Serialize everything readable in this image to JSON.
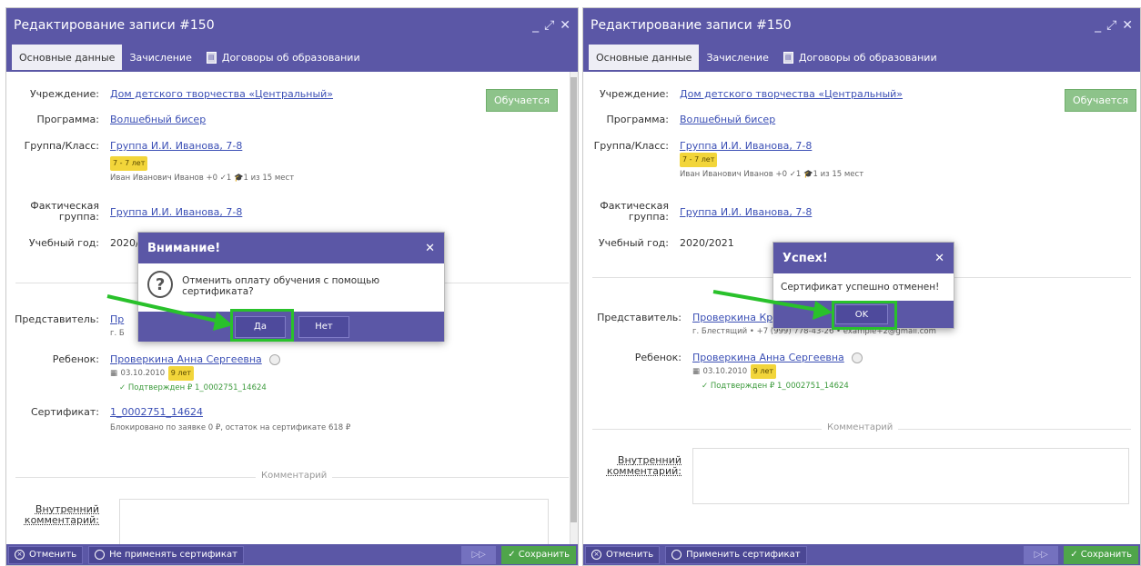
{
  "left": {
    "window_title": "Редактирование записи #150",
    "tabs": [
      "Основные данные",
      "Зачисление",
      "Договоры об образовании"
    ],
    "status": "Обучается",
    "fields": {
      "institution_label": "Учреждение:",
      "institution": "Дом детского творчества «Центральный»",
      "program_label": "Программа:",
      "program": "Волшебный бисер",
      "group_label": "Группа/Класс:",
      "group": "Группа И.И. Иванова, 7-8",
      "age_badge": "7 - 7 лет",
      "teacher_line": "Иван Иванович Иванов   +0  ✓1  🎓1   из 15 мест",
      "actual_group_label": "Фактическая группа:",
      "actual_group": "Группа И.И. Иванова, 7-8",
      "year_label": "Учебный год:",
      "year": "2020/",
      "rep_label": "Представитель:",
      "rep_partial": "Пр",
      "rep_sub": "г. Б",
      "child_label": "Ребенок:",
      "child": "Проверкина Анна Сергеевна",
      "child_dob": "03.10.2010",
      "child_age": "9 лет",
      "child_confirm": "✓ Подтвержден   ₽ 1_0002751_14624",
      "cert_label": "Сертификат:",
      "cert": "1_0002751_14624",
      "cert_sub": "Блокировано по заявке 0 ₽, остаток на сертификате 618 ₽",
      "comment_section": "Комментарий",
      "internal_comment_label": "Внутренний комментарий:"
    },
    "footer": {
      "cancel": "Отменить",
      "no_cert": "Не применять сертификат",
      "next": "▷▷",
      "save": "✓ Сохранить"
    },
    "modal": {
      "title": "Внимание!",
      "message": "Отменить оплату обучения с помощью сертификата?",
      "yes": "Да",
      "no": "Нет"
    }
  },
  "right": {
    "window_title": "Редактирование записи #150",
    "tabs": [
      "Основные данные",
      "Зачисление",
      "Договоры об образовании"
    ],
    "status": "Обучается",
    "fields": {
      "institution_label": "Учреждение:",
      "institution": "Дом детского творчества «Центральный»",
      "program_label": "Программа:",
      "program": "Волшебный бисер",
      "group_label": "Группа/Класс:",
      "group": "Группа И.И. Иванова, 7-8",
      "age_badge": "7 - 7 лет",
      "teacher_line": "Иван Иванович Иванов   +0  ✓1  🎓1   из 15 мест",
      "actual_group_label": "Фактическая группа:",
      "actual_group": "Группа И.И. Иванова, 7-8",
      "year_label": "Учебный год:",
      "year": "2020/2021",
      "rep_label": "Представитель:",
      "rep_partial": "Проверкина Кри",
      "rep_sub": "г. Блестящий • +7 (999) 778-43-26 • example+2@gmail.com",
      "child_label": "Ребенок:",
      "child": "Проверкина Анна Сергеевна",
      "child_dob": "03.10.2010",
      "child_age": "9 лет",
      "child_confirm": "✓ Подтвержден   ₽ 1_0002751_14624",
      "comment_section": "Комментарий",
      "internal_comment_label": "Внутренний комментарий:"
    },
    "footer": {
      "cancel": "Отменить",
      "apply_cert": "Применить сертификат",
      "next": "▷▷",
      "save": "✓ Сохранить"
    },
    "modal": {
      "title": "Успех!",
      "message": "Сертификат успешно отменен!",
      "ok": "OK"
    }
  },
  "colors": {
    "header": "#5b57a6",
    "highlight": "#29c12b",
    "status": "#8dc38a",
    "save": "#4fa54b"
  }
}
